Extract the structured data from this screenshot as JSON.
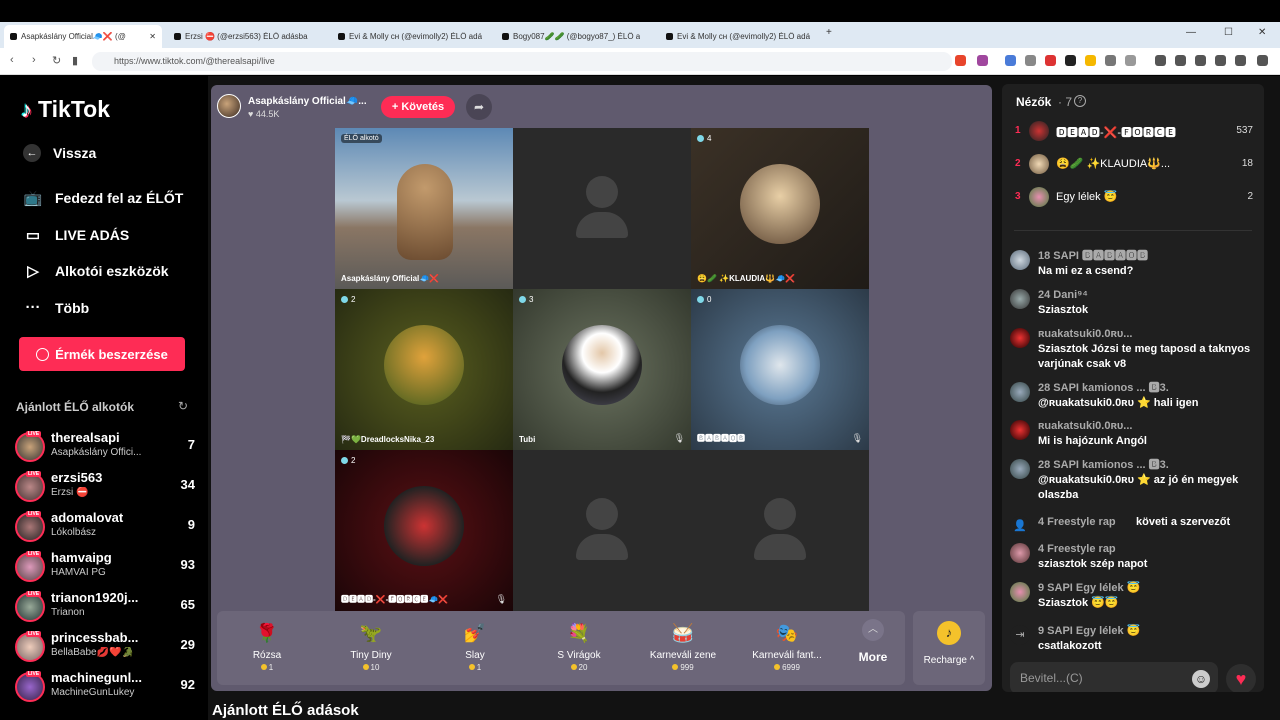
{
  "browser": {
    "tabs": [
      {
        "label": "Asapkáslány Official🧢❌ (@"
      },
      {
        "label": "Erzsi ⛔ (@erzsi563) ÉLŐ adásba"
      },
      {
        "label": "Evi & Molly ᴄʜ (@evimolly2) ÉLŐ adá"
      },
      {
        "label": "Bogy087🥒🥒 (@bogyo87_) ÉLŐ a"
      },
      {
        "label": "Evi & Molly ᴄʜ (@evimolly2) ÉLŐ adá"
      }
    ],
    "url": "https://www.tiktok.com/@therealsapi/live"
  },
  "sidebar": {
    "logo": "TikTok",
    "back": "Vissza",
    "nav": [
      {
        "label": "Fedezd fel az ÉLŐT"
      },
      {
        "label": "LIVE ADÁS"
      },
      {
        "label": "Alkotói eszközök"
      },
      {
        "label": "Több"
      }
    ],
    "coins_button": "Érmék beszerzése",
    "recommended_title": "Ajánlott ÉLŐ alkotók",
    "live_tag": "LIVE",
    "creators": [
      {
        "name": "therealsapi",
        "sub": "Asapkáslány Offici...",
        "count": "7"
      },
      {
        "name": "erzsi563",
        "sub": "Erzsi ⛔",
        "count": "34"
      },
      {
        "name": "adomalovat",
        "sub": "Lókolbász",
        "count": "9"
      },
      {
        "name": "hamvaipg",
        "sub": "HAMVAI PG",
        "count": "93"
      },
      {
        "name": "trianon1920j...",
        "sub": "Trianon",
        "count": "65"
      },
      {
        "name": "princessbab...",
        "sub": "BellaBabe💋❤️🐊",
        "count": "29"
      },
      {
        "name": "machinegunl...",
        "sub": "MachineGunLukey",
        "count": "92"
      }
    ]
  },
  "stage": {
    "host_name": "Asapkáslány Official🧢...",
    "host_likes": "♥ 44.5K",
    "follow": "+ Követés",
    "cells": [
      {
        "label": "Asapkáslány Official🧢❌",
        "tag": "ÉLŐ alkotó",
        "count": ""
      },
      {
        "label": "",
        "count": ""
      },
      {
        "label": "😩🥒 ✨KLAUDIA🔱🧢❌",
        "count": "4"
      },
      {
        "label": "🏁💚DreadlocksNika_23",
        "count": "2"
      },
      {
        "label": "Tubi",
        "count": "3"
      },
      {
        "label": "🅱🅰🅱🅰🅾🅱",
        "count": "0"
      },
      {
        "label": "🅳🅴🅰🅳-❌-🅵🅾🆁🅲🅴🧢❌",
        "count": "2"
      },
      {
        "label": "",
        "count": ""
      },
      {
        "label": "",
        "count": ""
      }
    ],
    "gifts": [
      {
        "name": "Rózsa",
        "price": "1",
        "icon": "🌹"
      },
      {
        "name": "Tiny Diny",
        "price": "10",
        "icon": "🦖"
      },
      {
        "name": "Slay",
        "price": "1",
        "icon": "💅"
      },
      {
        "name": "S Virágok",
        "price": "20",
        "icon": "💐"
      },
      {
        "name": "Karneváli zene",
        "price": "999",
        "icon": "🥁"
      },
      {
        "name": "Karneváli fant...",
        "price": "6999",
        "icon": "🎭"
      }
    ],
    "more": "More",
    "recharge": "Recharge ^"
  },
  "section_title": "Ajánlott ÉLŐ adások",
  "chat": {
    "viewers_title": "Nézők",
    "viewers_count": "· 7",
    "viewers": [
      {
        "rank": "1",
        "name": "🅳🅴🅰🅳-❌-🅵🅾🆁🅲🅴",
        "score": "537"
      },
      {
        "rank": "2",
        "name": "😩🥒 ✨KLAUDIA🔱...",
        "score": "18"
      },
      {
        "rank": "3",
        "name": "Egy lélek 😇",
        "score": "2"
      }
    ],
    "messages": [
      {
        "head": "18  SAPI  🅱🅰🅱🅰🅾🅱",
        "text": "Na mi ez a csend?"
      },
      {
        "head": "24  Dani⁹⁴",
        "text": "Sziasztok"
      },
      {
        "head": "ʀuakatsuki0.0ʀᴜ...",
        "text": "Sziasztok Józsi te meg taposd a taknyos varjúnak csak v8"
      },
      {
        "head": "28  SAPI  kamionos ... 🅱3.",
        "text": "@ʀuakatsuki0.0ʀᴜ ⭐ hali igen"
      },
      {
        "head": "ʀuakatsuki0.0ʀᴜ...",
        "text": "Mi is hajózunk Angól"
      },
      {
        "head": "28  SAPI  kamionos ... 🅱3.",
        "text": "@ʀuakatsuki0.0ʀᴜ ⭐ az jó én megyek olaszba"
      },
      {
        "head": "4  Freestyle rap",
        "text": "követi a szervezőt"
      },
      {
        "head": "4  Freestyle rap",
        "text": "sziasztok szép napot"
      },
      {
        "head": "9  SAPI  Egy lélek 😇",
        "text": "Sziasztok 😇😇"
      },
      {
        "head": "9  SAPI  Egy lélek 😇",
        "text": "csatlakozott"
      }
    ],
    "input_placeholder": "Bevitel...(C)"
  }
}
